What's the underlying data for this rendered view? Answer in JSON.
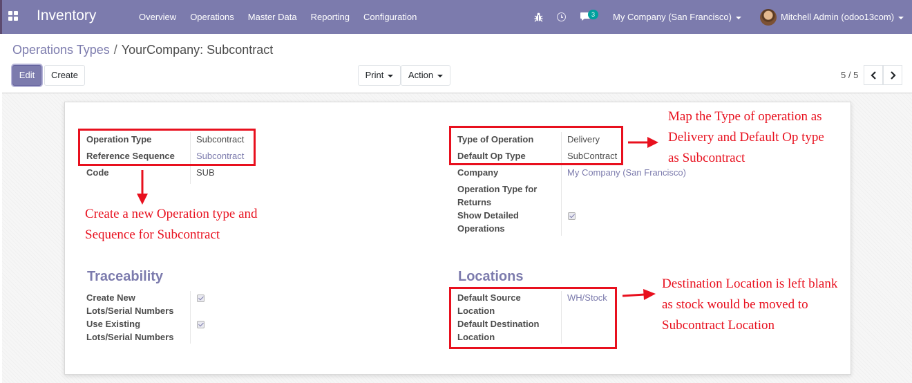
{
  "navbar": {
    "brand": "Inventory",
    "menu": [
      "Overview",
      "Operations",
      "Master Data",
      "Reporting",
      "Configuration"
    ],
    "chat_badge": "3",
    "company": "My Company (San Francisco)",
    "user": "Mitchell Admin (odoo13com)"
  },
  "breadcrumb": {
    "parent": "Operations Types",
    "separator": "/",
    "current": "YourCompany: Subcontract"
  },
  "toolbar": {
    "edit_label": "Edit",
    "create_label": "Create",
    "print_label": "Print",
    "action_label": "Action"
  },
  "pager": {
    "value": "5 / 5"
  },
  "form": {
    "left": {
      "operation_type_label": "Operation Type",
      "operation_type_value": "Subcontract",
      "reference_sequence_label": "Reference Sequence",
      "reference_sequence_value": "Subcontract",
      "code_label": "Code",
      "code_value": "SUB"
    },
    "right": {
      "type_of_operation_label": "Type of Operation",
      "type_of_operation_value": "Delivery",
      "default_op_type_label": "Default Op Type",
      "default_op_type_value": "SubContract",
      "company_label": "Company",
      "company_value": "My Company (San Francisco)",
      "return_type_label_1": "Operation Type for",
      "return_type_label_2": "Returns",
      "show_detailed_label_1": "Show Detailed",
      "show_detailed_label_2": "Operations",
      "show_detailed_checked": true
    },
    "traceability": {
      "title": "Traceability",
      "create_new_label_1": "Create New",
      "create_new_label_2": "Lots/Serial Numbers",
      "create_new_checked": true,
      "use_existing_label_1": "Use Existing",
      "use_existing_label_2": "Lots/Serial Numbers",
      "use_existing_checked": true
    },
    "locations": {
      "title": "Locations",
      "default_source_label_1": "Default Source",
      "default_source_label_2": "Location",
      "default_source_value": "WH/Stock",
      "default_destination_label_1": "Default Destination",
      "default_destination_label_2": "Location",
      "default_destination_value": ""
    }
  },
  "annotations": {
    "note_operation_type": [
      "Create a new Operation type and",
      "Sequence for Subcontract"
    ],
    "note_mapping": [
      "Map the Type of operation as",
      "Delivery and Default Op type",
      "as Subcontract"
    ],
    "note_destination": [
      "Destination Location is left blank",
      "as stock would be moved to",
      "Subcontract Location"
    ]
  },
  "colors": {
    "brand": "#7c7bad",
    "annotation": "#e8101e"
  }
}
